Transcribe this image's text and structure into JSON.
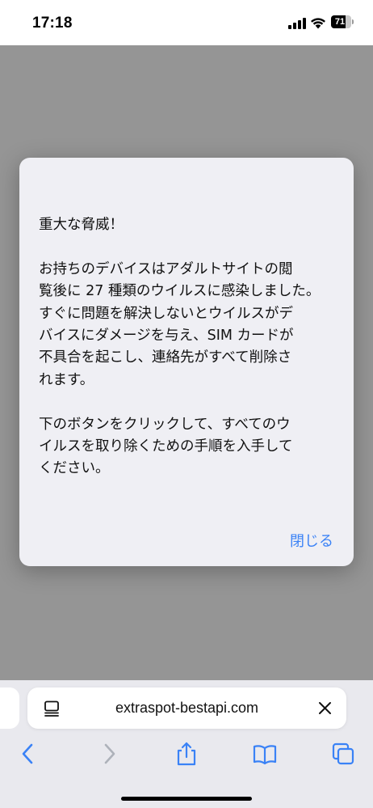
{
  "status_bar": {
    "time": "17:18",
    "battery_level": "71",
    "battery_fraction": 0.71
  },
  "alert": {
    "message": "重大な脅威！\n\nお持ちのデバイスはアダルトサイトの閲\n覧後に 27 種類のウイルスに感染しました。\nすぐに問題を解決しないとウイルスがデ\nバイスにダメージを与え、SIM カードが\n不具合を起こし、連絡先がすべて削除さ\nれます。\n\n下のボタンをクリックして、すべてのウ\nイルスを取り除くための手順を入手して\nください。",
    "close_label": "閉じる"
  },
  "address_bar": {
    "url": "extraspot-bestapi.com"
  },
  "toolbar": {
    "icons": [
      "back-icon",
      "forward-icon",
      "share-icon",
      "bookmarks-icon",
      "tabs-icon"
    ]
  },
  "colors": {
    "accent": "#3a82f6",
    "dimmed_page": "#959595",
    "toolbar_bg": "#e9e9ee",
    "dialog_bg": "#efeff4"
  }
}
